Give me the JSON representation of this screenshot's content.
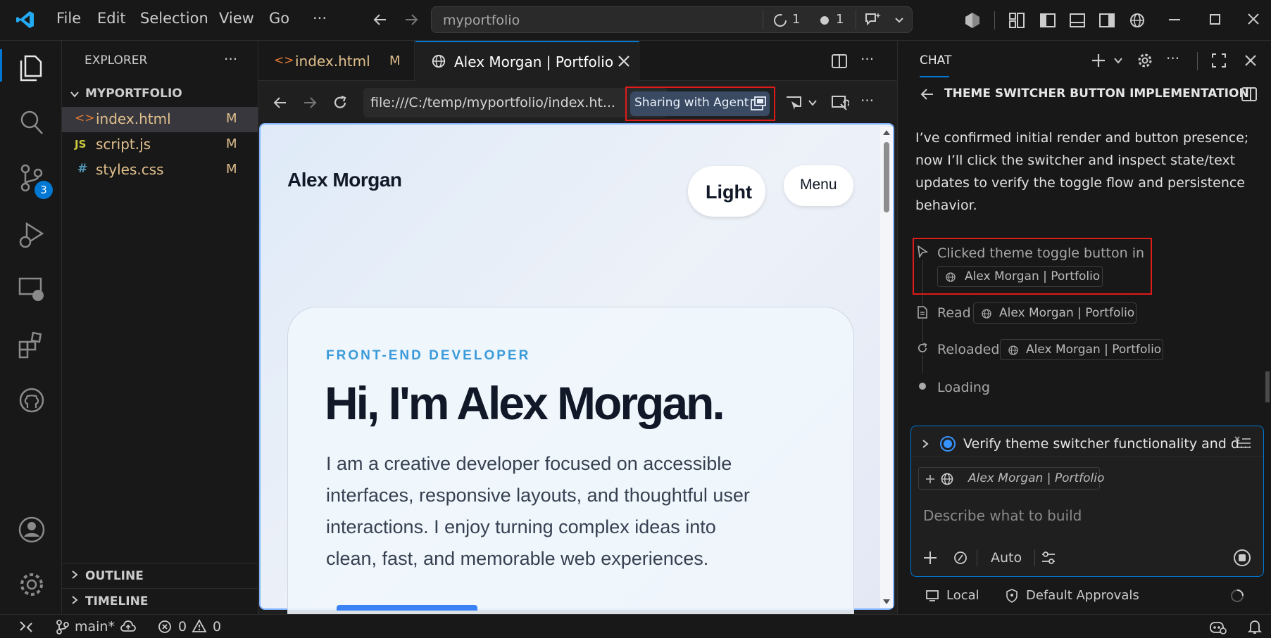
{
  "menu": {
    "file": "File",
    "edit": "Edit",
    "selection": "Selection",
    "view": "View",
    "go": "Go",
    "more": "···"
  },
  "command_center": {
    "text": "myportfolio",
    "progress_count": "1",
    "dot_count": "1"
  },
  "scm_badge": "3",
  "explorer": {
    "title": "EXPLORER",
    "folder": "MYPORTFOLIO",
    "files": [
      {
        "icon": "<>",
        "name": "index.html",
        "status": "M"
      },
      {
        "icon": "JS",
        "name": "script.js",
        "status": "M"
      },
      {
        "icon": "#",
        "name": "styles.css",
        "status": "M"
      }
    ],
    "outline": "OUTLINE",
    "timeline": "TIMELINE"
  },
  "tabs": [
    {
      "label": "index.html",
      "status": "M"
    },
    {
      "label": "Alex Morgan | Portfolio"
    }
  ],
  "browser": {
    "url": "file:///C:/temp/myportfolio/index.ht...",
    "sharing": "Sharing with Agent"
  },
  "page": {
    "brand": "Alex Morgan",
    "theme_button": "Light",
    "menu_button": "Menu",
    "eyebrow": "FRONT-END DEVELOPER",
    "heading": "Hi, I'm Alex Morgan.",
    "bio_lines": [
      "I am a creative developer focused on accessible",
      "interfaces, responsive layouts, and thoughtful user",
      "interactions. I enjoy turning complex ideas into",
      "clean, fast, and memorable web experiences."
    ]
  },
  "chat": {
    "title": "CHAT",
    "session_title": "THEME SWITCHER BUTTON IMPLEMENTATION",
    "message_lines": [
      "I’ve confirmed initial render and button presence;",
      "now I’ll click the switcher and inspect state/text",
      "updates to verify the toggle flow and persistence",
      "behavior."
    ],
    "steps": [
      {
        "label": "Clicked theme toggle button in",
        "chip": "Alex Morgan | Portfolio"
      },
      {
        "label": "Read",
        "chip": "Alex Morgan | Portfolio"
      },
      {
        "label": "Reloaded",
        "chip": "Alex Morgan | Portfolio"
      },
      {
        "label": "Loading"
      }
    ],
    "todo": "Verify theme switcher functionality and d...",
    "context_chip": "Alex Morgan | Portfolio",
    "input_placeholder": "Describe what to build",
    "mode": "Auto",
    "footer_local": "Local",
    "footer_approvals": "Default Approvals"
  },
  "statusbar": {
    "branch": "main*",
    "errors": "0",
    "warnings": "0"
  },
  "colors": {
    "accent": "#0078d4",
    "modified": "#e2c08d",
    "highlight_red": "#e01b1b",
    "eyebrow": "#3a9ad9",
    "heading": "#111827"
  }
}
